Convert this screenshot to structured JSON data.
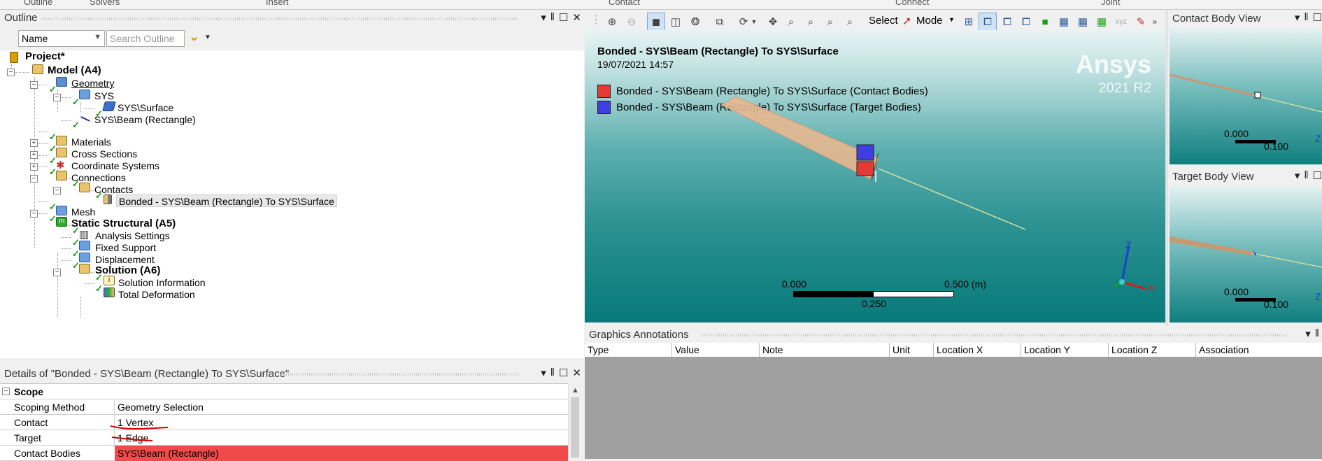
{
  "top_strip": [
    "Outline",
    "Solvers",
    "Insert",
    "Contact",
    "Connect",
    "Joint"
  ],
  "outline": {
    "title": "Outline",
    "buttons": [
      "▾",
      "📌",
      "☐",
      "✕"
    ],
    "filter_select": "Name",
    "search_placeholder": "Search Outline",
    "tree": [
      {
        "label": "Project*",
        "bold": true
      },
      {
        "label": "Model (A4)",
        "bold": true
      },
      {
        "label": "Geometry",
        "underline": true
      },
      {
        "label": "SYS"
      },
      {
        "label": "SYS\\Surface"
      },
      {
        "label": "SYS\\Beam (Rectangle)"
      },
      {
        "label": "Materials"
      },
      {
        "label": "Cross Sections"
      },
      {
        "label": "Coordinate Systems"
      },
      {
        "label": "Connections"
      },
      {
        "label": "Contacts"
      },
      {
        "label": "Bonded - SYS\\Beam (Rectangle) To SYS\\Surface",
        "selected": true
      },
      {
        "label": "Mesh"
      },
      {
        "label": "Static Structural (A5)",
        "bold": true
      },
      {
        "label": "Analysis Settings"
      },
      {
        "label": "Fixed Support"
      },
      {
        "label": "Displacement"
      },
      {
        "label": "Solution (A6)",
        "bold": true
      },
      {
        "label": "Solution Information"
      },
      {
        "label": "Total Deformation"
      }
    ]
  },
  "details": {
    "title": "Details of \"Bonded - SYS\\Beam (Rectangle) To SYS\\Surface\"",
    "group": "Scope",
    "rows": [
      {
        "key": "Scoping Method",
        "value": "Geometry Selection"
      },
      {
        "key": "Contact",
        "value": "1 Vertex"
      },
      {
        "key": "Target",
        "value": "1 Edge"
      },
      {
        "key": "Contact Bodies",
        "value": "SYS\\Beam (Rectangle)"
      }
    ]
  },
  "toolbar": {
    "select_label": "Select",
    "mode_label": "Mode"
  },
  "graphics": {
    "title": "Bonded - SYS\\Beam (Rectangle) To SYS\\Surface",
    "date": "19/07/2021 14:57",
    "legend": [
      {
        "label": "Bonded - SYS\\Beam (Rectangle) To SYS\\Surface (Contact Bodies)",
        "color": "#e53935"
      },
      {
        "label": "Bonded - SYS\\Beam (Rectangle) To SYS\\Surface (Target Bodies)",
        "color": "#3f3fe0"
      }
    ],
    "brand": "Ansys",
    "version": "2021 R2",
    "scale_start": "0.000",
    "scale_end": "0.500 (m)",
    "scale_mid": "0.250",
    "axis_z": "Z",
    "axis_x": "X"
  },
  "contact_view": {
    "title": "Contact Body View",
    "scale_start": "0.000",
    "scale_end": "0.100",
    "axis": "Z"
  },
  "target_view": {
    "title": "Target Body View",
    "scale_start": "0.000",
    "scale_end": "0.100",
    "axis": "Z"
  },
  "annotations": {
    "title": "Graphics Annotations",
    "columns": [
      "Type",
      "Value",
      "Note",
      "Unit",
      "Location X",
      "Location Y",
      "Location Z",
      "Association"
    ]
  }
}
